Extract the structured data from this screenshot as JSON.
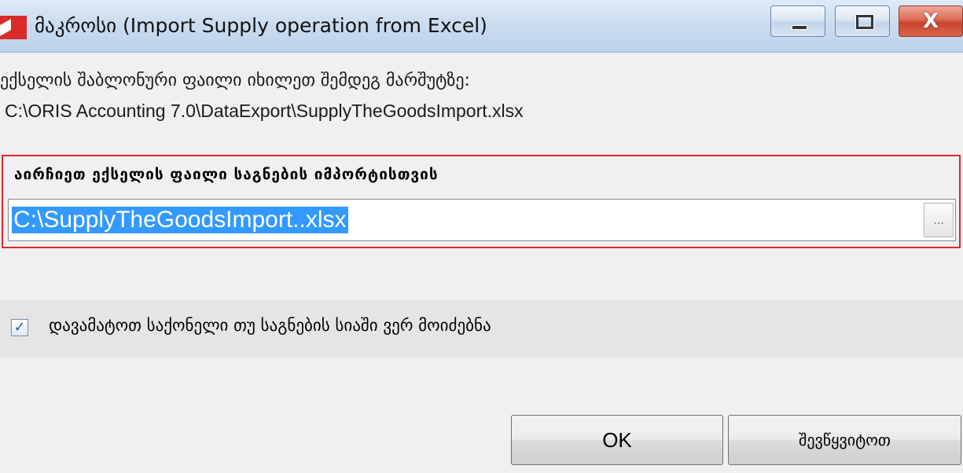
{
  "window": {
    "title": "მაკროსი (Import Supply operation from Excel)",
    "minimize_glyph": "",
    "maximize_glyph": "",
    "close_glyph": "X"
  },
  "info": {
    "line1": "ექსელის შაბლონური ფაილი იხილეთ შემდეგ მარშუტზე:",
    "line2": "C:\\ORIS Accounting 7.0\\DataExport\\SupplyTheGoodsImport.xlsx"
  },
  "file_select": {
    "label": "აირჩიეთ ექსელის ფაილი საგნების იმპორტისთვის",
    "value": "C:\\SupplyTheGoodsImport..xlsx",
    "browse_label": "..."
  },
  "option": {
    "checked": true,
    "check_glyph": "✓",
    "label": "დავამატოთ საქონელი თუ საგნების სიაში ვერ მოიძებნა"
  },
  "buttons": {
    "ok": "OK",
    "cancel": "შევწყვიტოთ"
  }
}
